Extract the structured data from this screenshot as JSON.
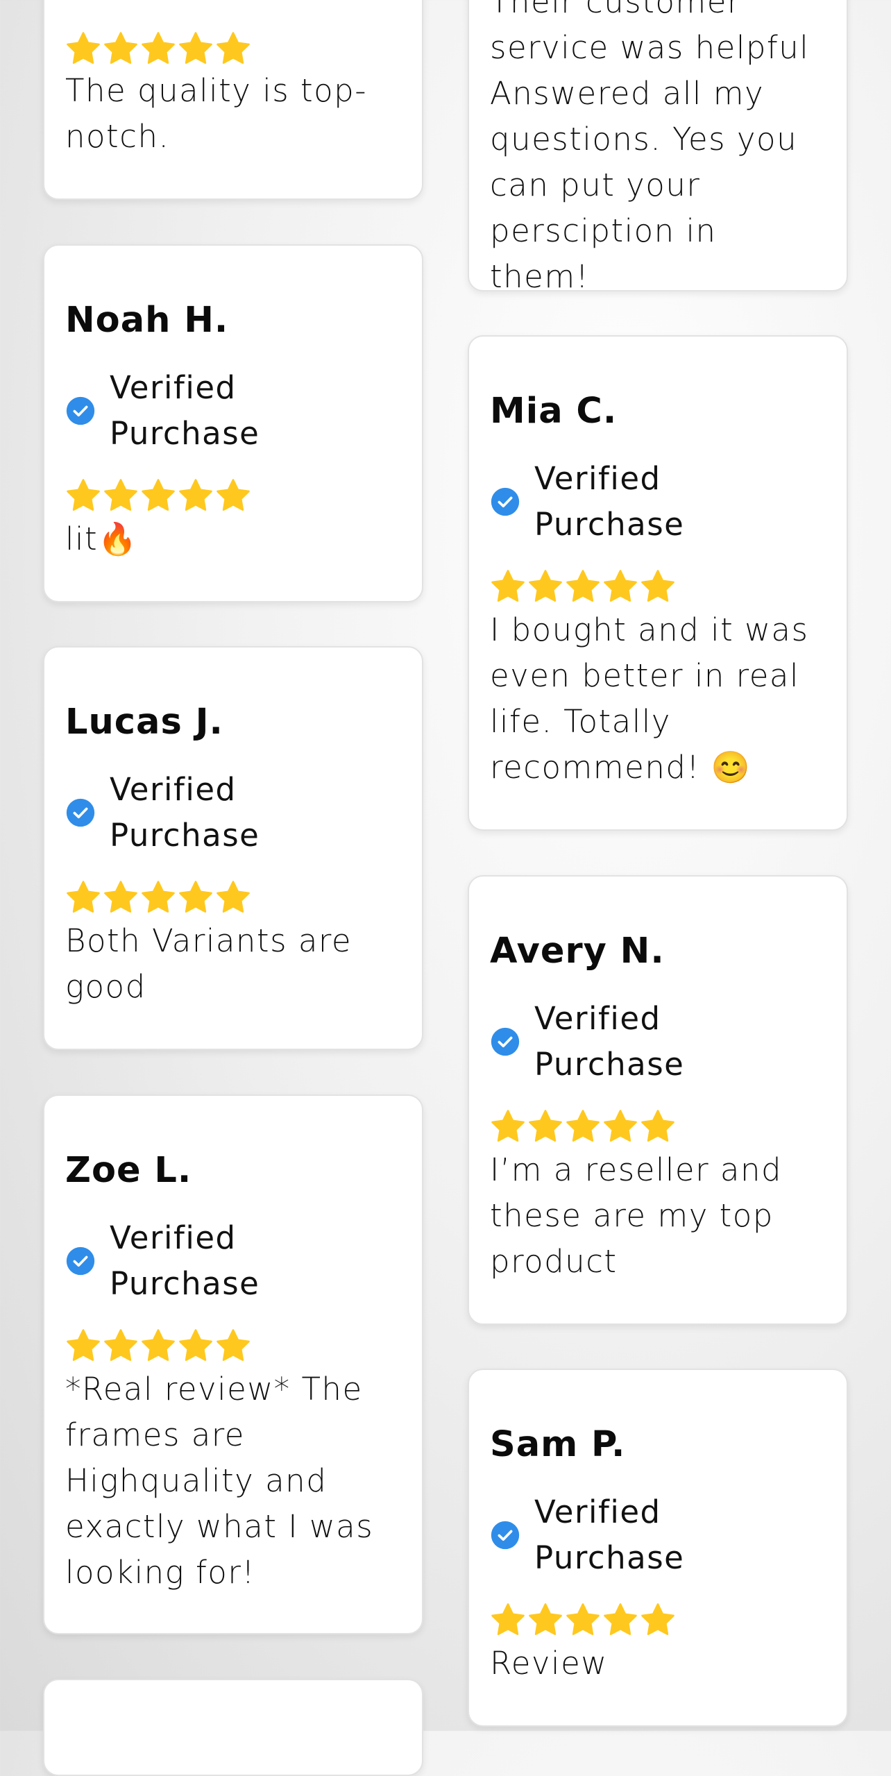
{
  "star_color": "#FFC81E",
  "check_color": "#2F8DE9",
  "verified_label": "Verified\nPurchase",
  "reviews": {
    "left_top": {
      "rating": 5,
      "text": "The quality is top-\nnotch."
    },
    "right_top": {
      "text": "Their customer\nservice was helpful\nAnswered all my\nquestions. Yes you\ncan put your\npersciption in them!"
    },
    "noah": {
      "name": "Noah H.",
      "rating": 5,
      "text": "lit🔥"
    },
    "lucas": {
      "name": "Lucas J.",
      "rating": 5,
      "text": "Both Variants are\ngood"
    },
    "zoe": {
      "name": "Zoe L.",
      "rating": 5,
      "text": "*Real review* The\nframes are\nHighquality and\nexactly what I was\nlooking for!"
    },
    "mia": {
      "name": "Mia C.",
      "rating": 5,
      "text": "I bought and it was\neven better in real\nlife. Totally\nrecommend! 😊"
    },
    "avery": {
      "name": "Avery N.",
      "rating": 5,
      "text": "I’m a reseller and\nthese are my top\nproduct"
    },
    "sam": {
      "name": "Sam P.",
      "rating": 5,
      "text": "Review"
    }
  }
}
